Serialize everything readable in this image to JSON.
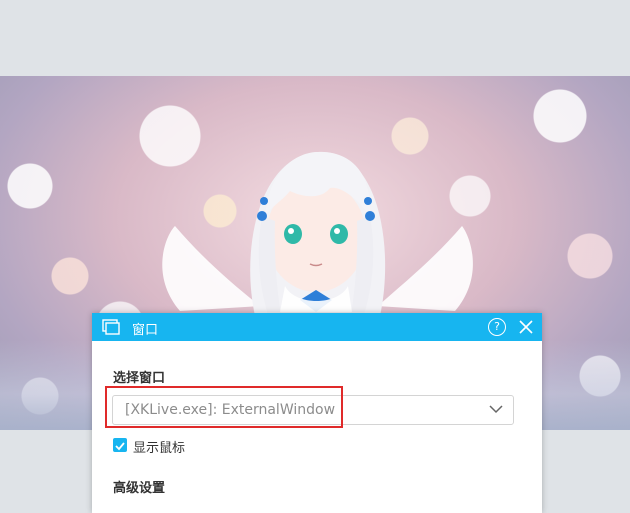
{
  "dialog": {
    "title": "窗口",
    "help_glyph": "?",
    "select_window_label": "选择窗口",
    "selected_window": "[XKLive.exe]: ExternalWindow",
    "show_cursor_label": "显示鼠标",
    "show_cursor_checked": true,
    "advanced_label": "高级设置"
  },
  "colors": {
    "accent": "#17b5f0",
    "highlight_border": "#e02a2a"
  }
}
